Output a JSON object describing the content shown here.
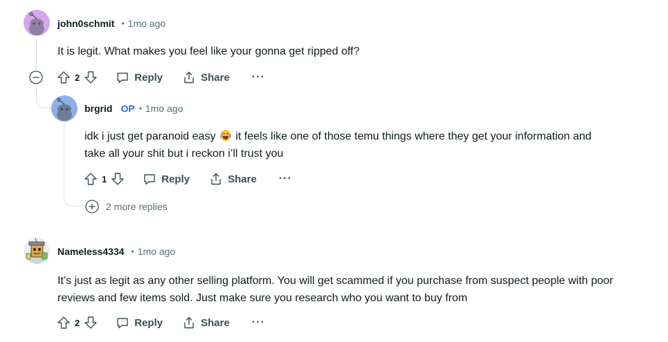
{
  "comments": [
    {
      "username": "john0schmit",
      "time": "1mo ago",
      "text": "It is legit. What makes you feel like your gonna get ripped off?",
      "votes": "2",
      "reply_label": "Reply",
      "share_label": "Share",
      "more_label": "···"
    },
    {
      "username": "brgrid",
      "op_badge": "OP",
      "time": "1mo ago",
      "text_before_emoji": "idk i just get paranoid easy ",
      "text_after_emoji": " it feels like one of those temu things where they get your information and",
      "text_line2": "take all your shit but i reckon i’ll trust you",
      "votes": "1",
      "reply_label": "Reply",
      "share_label": "Share",
      "more_label": "···",
      "more_replies": "2 more replies"
    },
    {
      "username": "Nameless4334",
      "time": "1mo ago",
      "text_line1": "It’s just as legit as any other selling platform. You will get scammed if you purchase from suspect people with poor",
      "text_line2": "reviews and few items sold. Just make sure you research who you want to buy from",
      "votes": "2",
      "reply_label": "Reply",
      "share_label": "Share",
      "more_label": "···"
    }
  ],
  "separator": "•",
  "colors": {
    "op": "#2a6fd6",
    "muted": "#576f76",
    "action": "#384f55"
  }
}
